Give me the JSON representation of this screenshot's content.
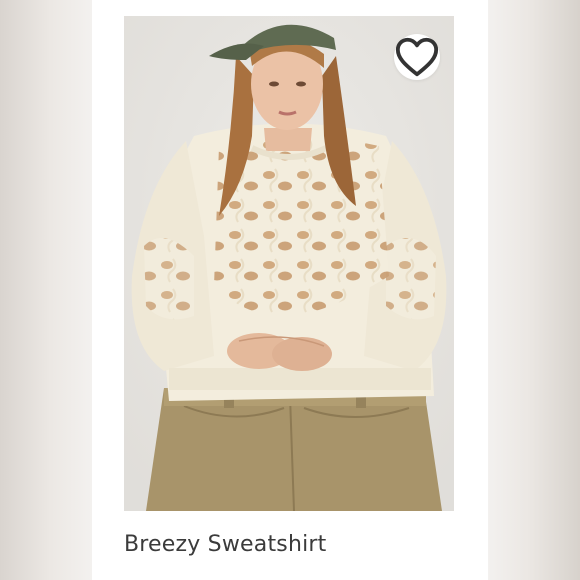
{
  "product": {
    "title": "Breezy Sweatshirt",
    "image_alt": "Model wearing a cream cutout lace sweatshirt with a green cap and khaki jeans"
  },
  "actions": {
    "favorite_icon": "heart-outline-icon"
  },
  "colors": {
    "sweater": "#f3eddd",
    "jeans": "#a8946a",
    "cap": "#5f6b52",
    "hair": "#a9713f",
    "background": "#e7e5e1"
  }
}
